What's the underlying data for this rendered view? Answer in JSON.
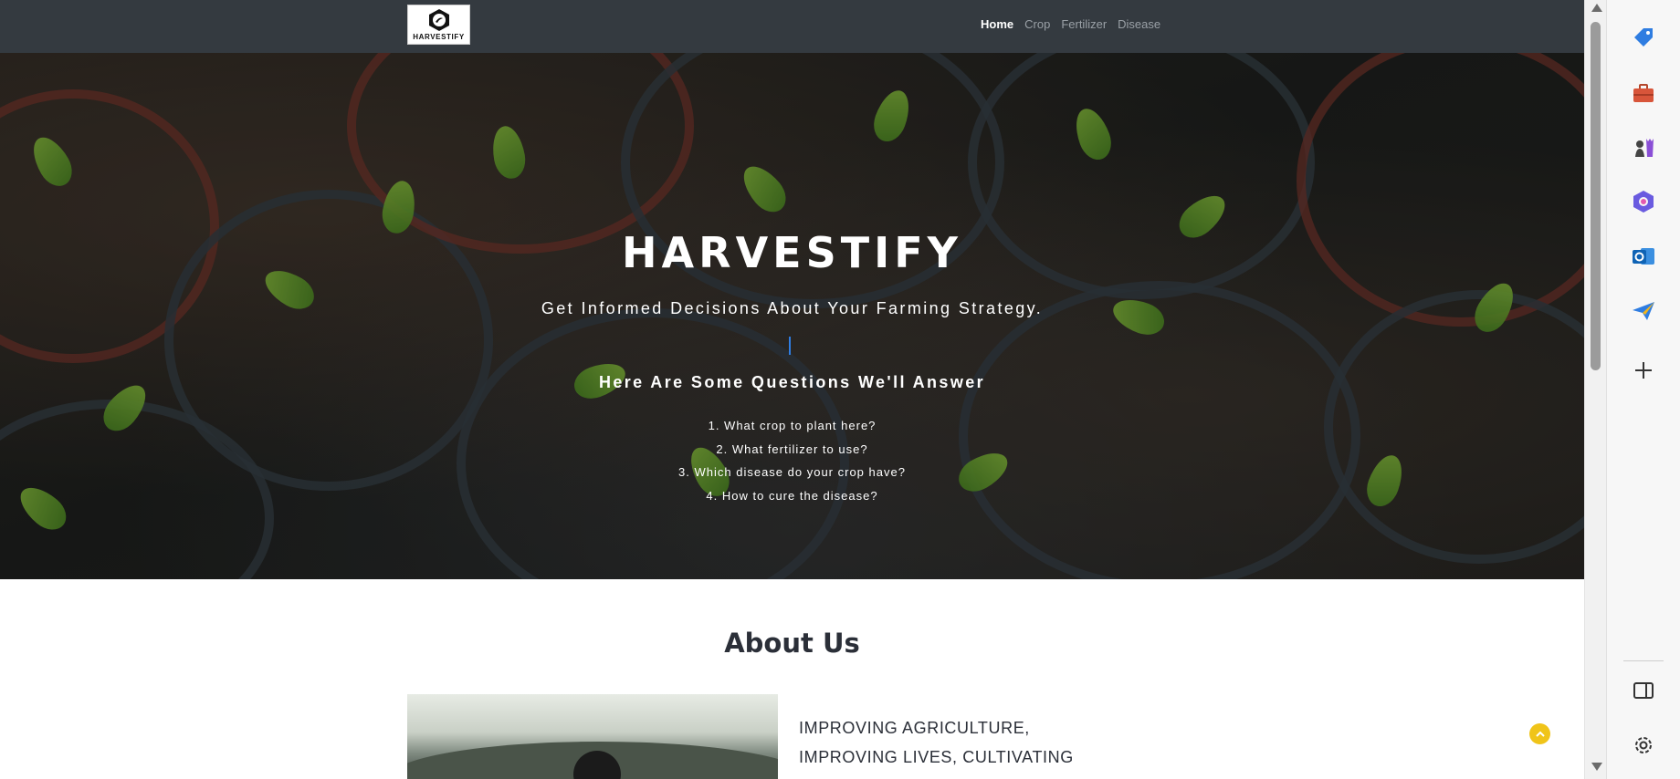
{
  "nav": {
    "brand_text": "HARVESTIFY",
    "links": [
      "Home",
      "Crop",
      "Fertilizer",
      "Disease"
    ]
  },
  "hero": {
    "title": "HARVESTIFY",
    "subtitle": "Get Informed Decisions About Your Farming Strategy.",
    "questions_heading": "Here Are Some Questions We'll Answer",
    "questions": [
      "1. What crop to plant here?",
      "2. What fertilizer to use?",
      "3. Which disease do your crop have?",
      "4. How to cure the disease?"
    ]
  },
  "about": {
    "title": "About Us",
    "text": "IMPROVING AGRICULTURE, IMPROVING LIVES, CULTIVATING CROPS TO MAKE"
  },
  "sidebar_icons": [
    "tag-icon",
    "toolbox-icon",
    "chess-icon",
    "copilot-icon",
    "outlook-icon",
    "send-icon",
    "plus-icon",
    "sidebar-panel-icon",
    "settings-icon"
  ],
  "colors": {
    "navbar": "#343a40",
    "back_to_top": "#f0c419",
    "text_dark": "#2b2f38"
  }
}
